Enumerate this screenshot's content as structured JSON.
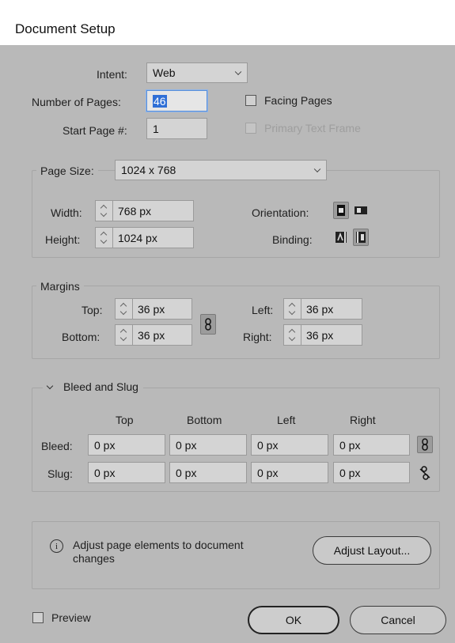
{
  "window": {
    "title": "Document Setup"
  },
  "intent": {
    "label": "Intent:",
    "value": "Web"
  },
  "pages": {
    "label": "Number of Pages:",
    "value": "46"
  },
  "facing_pages": {
    "label": "Facing Pages",
    "checked": false
  },
  "start_page": {
    "label": "Start Page #:",
    "value": "1"
  },
  "primary_text_frame": {
    "label": "Primary Text Frame",
    "checked": false,
    "enabled": false
  },
  "page_size": {
    "label": "Page Size:",
    "value": "1024 x 768",
    "width": {
      "label": "Width:",
      "value": "768 px"
    },
    "height": {
      "label": "Height:",
      "value": "1024 px"
    },
    "orientation": {
      "label": "Orientation:",
      "selected": "portrait",
      "icons": [
        "portrait-icon",
        "landscape-icon"
      ]
    },
    "binding": {
      "label": "Binding:",
      "selected": "right-to-left",
      "icons": [
        "left-to-right-binding-icon",
        "right-to-left-binding-icon"
      ]
    }
  },
  "margins": {
    "legend": "Margins",
    "top": {
      "label": "Top:",
      "value": "36 px"
    },
    "bottom": {
      "label": "Bottom:",
      "value": "36 px"
    },
    "left": {
      "label": "Left:",
      "value": "36 px"
    },
    "right": {
      "label": "Right:",
      "value": "36 px"
    },
    "link_icon": "chain-link-icon",
    "linked": true
  },
  "bleed_slug": {
    "legend": "Bleed and Slug",
    "columns": [
      "Top",
      "Bottom",
      "Left",
      "Right"
    ],
    "bleed": {
      "label": "Bleed:",
      "values": [
        "0 px",
        "0 px",
        "0 px",
        "0 px"
      ],
      "linked": true
    },
    "slug": {
      "label": "Slug:",
      "values": [
        "0 px",
        "0 px",
        "0 px",
        "0 px"
      ],
      "linked": false
    }
  },
  "adjust": {
    "message_line1": "Adjust page elements to document",
    "message_line2": "changes",
    "info_glyph": "i",
    "button": "Adjust Layout..."
  },
  "preview": {
    "label": "Preview",
    "checked": false
  },
  "buttons": {
    "ok": "OK",
    "cancel": "Cancel"
  }
}
